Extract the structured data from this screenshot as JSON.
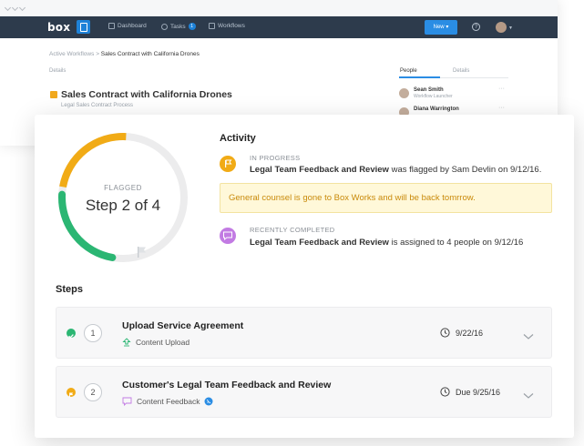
{
  "app": {
    "logo": "box",
    "nav": [
      {
        "label": "Dashboard",
        "icon": "grid-icon"
      },
      {
        "label": "Tasks",
        "icon": "check-circle-icon",
        "badge": "1"
      },
      {
        "label": "Workflows",
        "icon": "workflow-icon"
      }
    ],
    "new_button": "New",
    "help": "?"
  },
  "background": {
    "breadcrumb_parent": "Active Workflows",
    "breadcrumb_sep": ">",
    "breadcrumb_current": "Sales Contract with California Drones",
    "details_label": "Details",
    "title": "Sales Contract with California Drones",
    "subtitle": "Legal Sales Contract Process",
    "tabs": [
      "People",
      "Details"
    ],
    "people": [
      {
        "name": "Sean Smith",
        "role": "Workflow Launcher"
      },
      {
        "name": "Diana Warrington",
        "role": ""
      }
    ],
    "more": "···"
  },
  "progress": {
    "status": "FLAGGED",
    "label": "Step 2 of 4",
    "completed_fraction": 0.25,
    "flagged_fraction": 0.25
  },
  "activity": {
    "title": "Activity",
    "items": [
      {
        "status": "IN PROGRESS",
        "icon": "flag-icon",
        "bold": "Legal Team Feedback and Review",
        "text": " was flagged by Sam Devlin on 9/12/16."
      },
      {
        "status": "RECENTLY COMPLETED",
        "icon": "comment-icon",
        "bold": "Legal Team Feedback and Review",
        "text": " is assigned to 4 people on 9/12/16"
      }
    ],
    "notice": "General counsel is gone to Box Works and will be back tomrrow."
  },
  "steps": {
    "title": "Steps",
    "items": [
      {
        "number": "1",
        "name": "Upload Service Agreement",
        "sub": "Content Upload",
        "date": "9/22/16",
        "state": "complete"
      },
      {
        "number": "2",
        "name": "Customer's Legal Team Feedback and Review",
        "sub": "Content Feedback",
        "date": "Due 9/25/16",
        "state": "flagged"
      }
    ]
  },
  "colors": {
    "green": "#2bb673",
    "yellow": "#f1ab16",
    "purple": "#c27be3",
    "navy": "#2d3b4c",
    "blue": "#2a8de4"
  }
}
